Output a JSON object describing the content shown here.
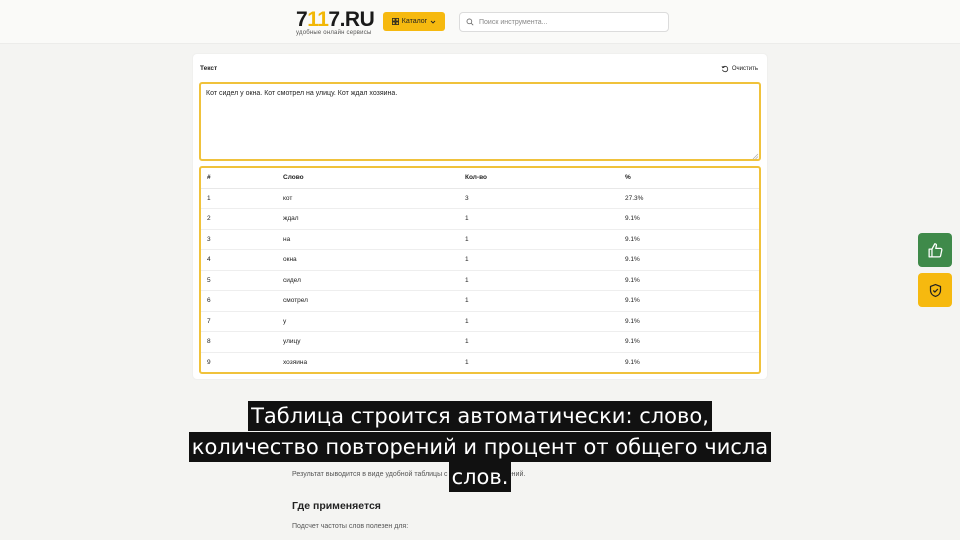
{
  "header": {
    "logo_part1": "7",
    "logo_accent": "11",
    "logo_part2": "7.RU",
    "logo_subtitle": "удобные онлайн сервисы",
    "catalog_label": "Каталог",
    "search_placeholder": "Поиск инструмента..."
  },
  "card": {
    "label": "Текст",
    "clear_label": "Очистить",
    "text_value": "Кот сидел у окна. Кот смотрел на улицу. Кот ждал хозяина."
  },
  "table": {
    "columns": [
      "#",
      "Слово",
      "Кол-во",
      "%"
    ],
    "rows": [
      [
        "1",
        "кот",
        "3",
        "27.3%"
      ],
      [
        "2",
        "ждал",
        "1",
        "9.1%"
      ],
      [
        "3",
        "на",
        "1",
        "9.1%"
      ],
      [
        "4",
        "окна",
        "1",
        "9.1%"
      ],
      [
        "5",
        "сидел",
        "1",
        "9.1%"
      ],
      [
        "6",
        "смотрел",
        "1",
        "9.1%"
      ],
      [
        "7",
        "у",
        "1",
        "9.1%"
      ],
      [
        "8",
        "улицу",
        "1",
        "9.1%"
      ],
      [
        "9",
        "хозяина",
        "1",
        "9.1%"
      ]
    ]
  },
  "article": {
    "result_text": "Результат выводится в виде удобной таблицы с подсчетом повторений.",
    "heading": "Где применяется",
    "usage_text": "Подсчет частоты слов полезен для:"
  },
  "caption": {
    "line1": "Таблица строится автоматически: слово,",
    "line2": "количество повторений и процент от общего числа",
    "line3": "слов."
  },
  "side_buttons": {
    "like_icon": "thumbs-up-icon",
    "shield_icon": "shield-check-icon",
    "like_color": "#3f8a4a",
    "shield_color": "#f6b90f"
  },
  "colors": {
    "accent": "#f6b90f",
    "border_highlight": "#f0c23b"
  }
}
